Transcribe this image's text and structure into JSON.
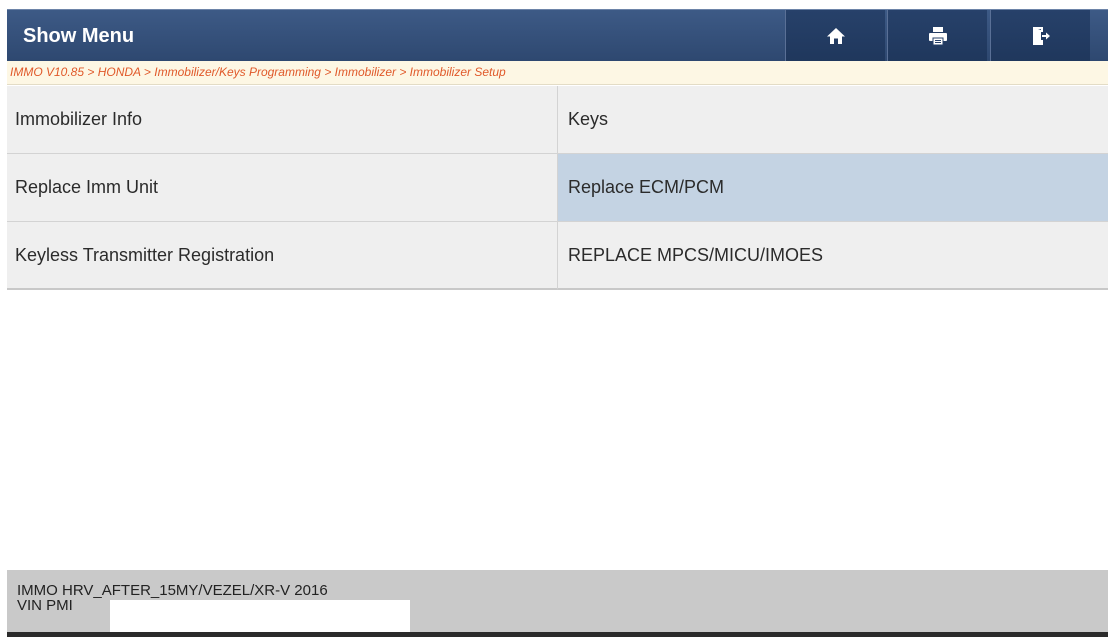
{
  "header": {
    "title": "Show Menu",
    "buttons": [
      {
        "icon": "home-icon"
      },
      {
        "icon": "print-icon"
      },
      {
        "icon": "exit-icon"
      }
    ]
  },
  "breadcrumb": "IMMO V10.85 > HONDA > Immobilizer/Keys Programming > Immobilizer > Immobilizer Setup",
  "menu": {
    "items": [
      {
        "label": "Immobilizer Info"
      },
      {
        "label": "Keys"
      },
      {
        "label": "Replace Imm Unit"
      },
      {
        "label": "Replace ECM/PCM",
        "selected": true
      },
      {
        "label": "Keyless Transmitter Registration"
      },
      {
        "label": "REPLACE MPCS/MICU/IMOES"
      }
    ]
  },
  "footer": {
    "vehicle": "IMMO HRV_AFTER_15MY/VEZEL/XR-V 2016",
    "vin_label": "VIN PMI"
  },
  "colors": {
    "header": "#2e4870",
    "breadcrumb_text": "#e0592a",
    "selected_item": "#c4d3e3",
    "footer": "#c9c9c9"
  }
}
